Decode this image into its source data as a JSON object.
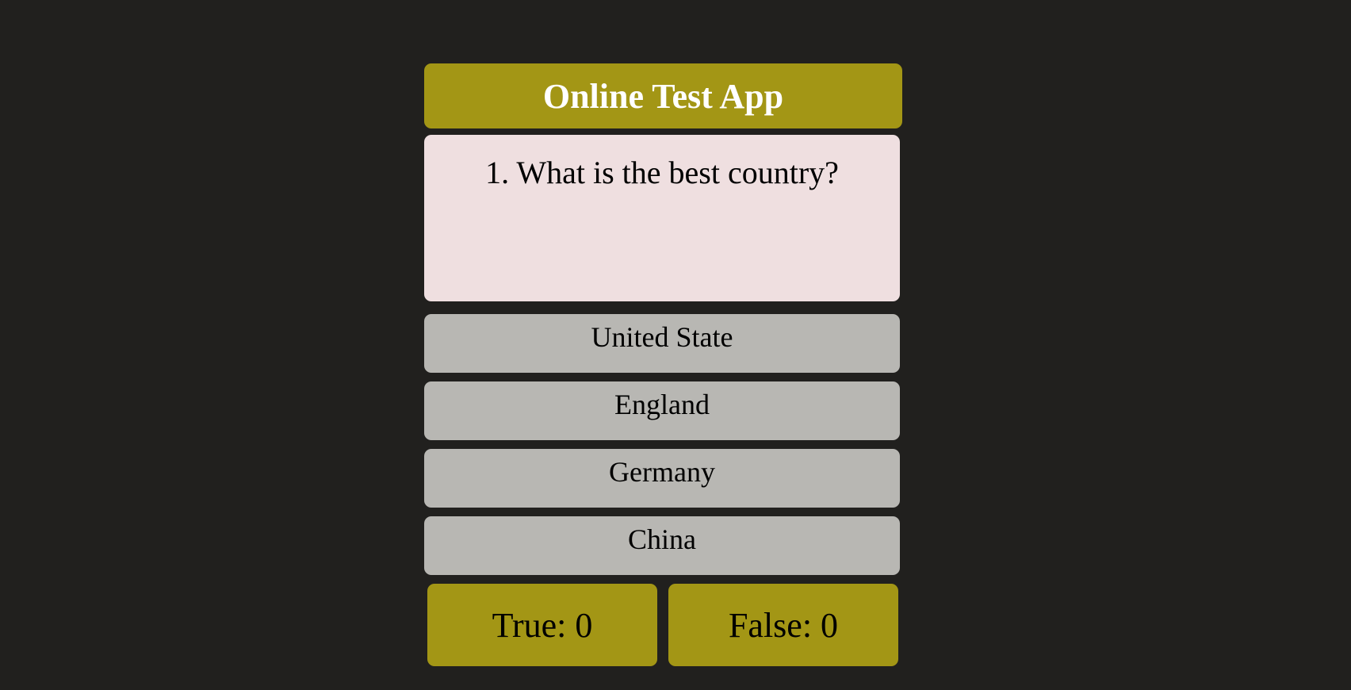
{
  "header": {
    "title": "Online Test App"
  },
  "question": {
    "text": "1. What is the best country?"
  },
  "options": [
    {
      "label": "United State"
    },
    {
      "label": "England"
    },
    {
      "label": "Germany"
    },
    {
      "label": "China"
    }
  ],
  "scores": {
    "true_label": "True: 0",
    "false_label": "False: 0"
  },
  "colors": {
    "background": "#21201e",
    "accent": "#a39615",
    "question_bg": "#efdfe0",
    "option_bg": "#b8b7b3"
  }
}
